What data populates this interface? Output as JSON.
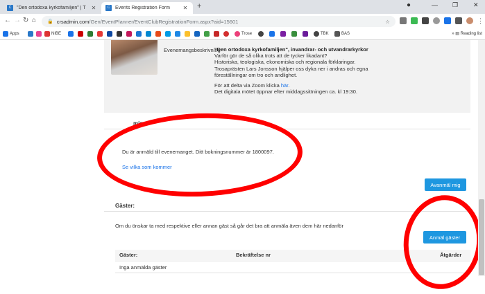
{
  "browser": {
    "tabs": [
      {
        "title": "\"Den ortodoxa kyrkofamiljen\" | T",
        "active": false
      },
      {
        "title": "Events Registration Form",
        "active": true
      }
    ],
    "new_tab": "+",
    "url_host": "crsadmin.com",
    "url_path": "/Gen/EventPlanner/EventClubRegistrationForm.aspx?aid=15601",
    "bookmarks": [
      "Apps",
      "NIBE",
      "Trose",
      "TBK",
      "BAS"
    ],
    "reading_list": "Reading list"
  },
  "event": {
    "description_label": "Evenemangsbeskrivning",
    "description_title": "\"Den ortodoxa kyrkofamiljen\", invandrar- och utvandrarkyrkor",
    "description_lines": [
      "Varför gör de så olika trots att de tycker likadant?",
      "Historiska, teologiska, ekonomiska och regionala förklaringar.",
      "Trosaprästen Lars Jonsson hjälper oss dyka ner i andras och egna",
      "föreställningar om tro och andlighet."
    ],
    "zoom_text": "För att delta via Zoom klicka",
    "zoom_link": "här",
    "zoom_end": ".",
    "dinner_text": "Det digitala mötet öppnar efter middagssittningen ca. kl 19:30."
  },
  "registration": {
    "section_title": "Anmäl mig",
    "section_title_visible": "mig",
    "confirmation": "Du är anmäld till evenemanget. Ditt bokningsnummer är 1800097.",
    "see_who_link": "Se vilka som kommer",
    "unregister_button": "Avanmäl mig"
  },
  "guests": {
    "section_title": "Gäster:",
    "info": "Om du önskar ta med respektive eller annan gäst så går det bra att anmäla även dem här nedanför",
    "register_button": "Anmäl gäster",
    "table": {
      "headers": [
        "Gäster:",
        "Bekräftelse nr",
        "Åtgärder"
      ],
      "empty_message": "Inga anmälda gäster"
    }
  },
  "colors": {
    "button_blue": "#1e97e0",
    "annotation_red": "#ff0000",
    "link_blue": "#1a73e8"
  }
}
